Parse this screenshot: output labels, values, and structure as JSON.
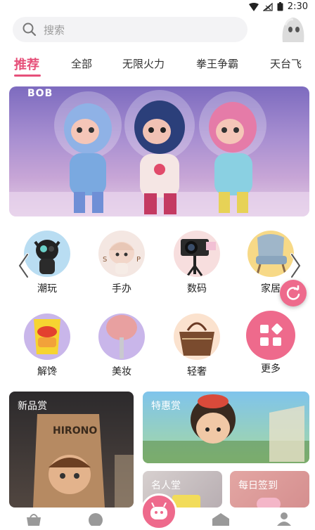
{
  "status_bar": {
    "time": "2:30"
  },
  "search": {
    "placeholder": "搜索"
  },
  "tabs": [
    {
      "label": "推荐",
      "active": true
    },
    {
      "label": "全部"
    },
    {
      "label": "无限火力"
    },
    {
      "label": "拳王争霸"
    },
    {
      "label": "天台飞"
    }
  ],
  "banner": {
    "brand_text": "BOB"
  },
  "categories": [
    {
      "label": "潮玩",
      "icon": "designer-toy-icon"
    },
    {
      "label": "手办",
      "icon": "figure-doll-icon"
    },
    {
      "label": "数码",
      "icon": "camera-icon"
    },
    {
      "label": "家居",
      "icon": "armchair-icon"
    },
    {
      "label": "解馋",
      "icon": "snack-bag-icon"
    },
    {
      "label": "美妆",
      "icon": "makeup-brush-icon"
    },
    {
      "label": "轻奢",
      "icon": "handbag-icon"
    },
    {
      "label": "更多",
      "icon": "grid-more-icon"
    }
  ],
  "cards": {
    "new": {
      "title": "新品赏"
    },
    "special": {
      "title": "特惠赏"
    },
    "fame": {
      "title": "名人堂"
    },
    "daily": {
      "title": "每日签到"
    }
  },
  "colors": {
    "accent": "#e6507a",
    "refresh": "#ee6a8c"
  }
}
